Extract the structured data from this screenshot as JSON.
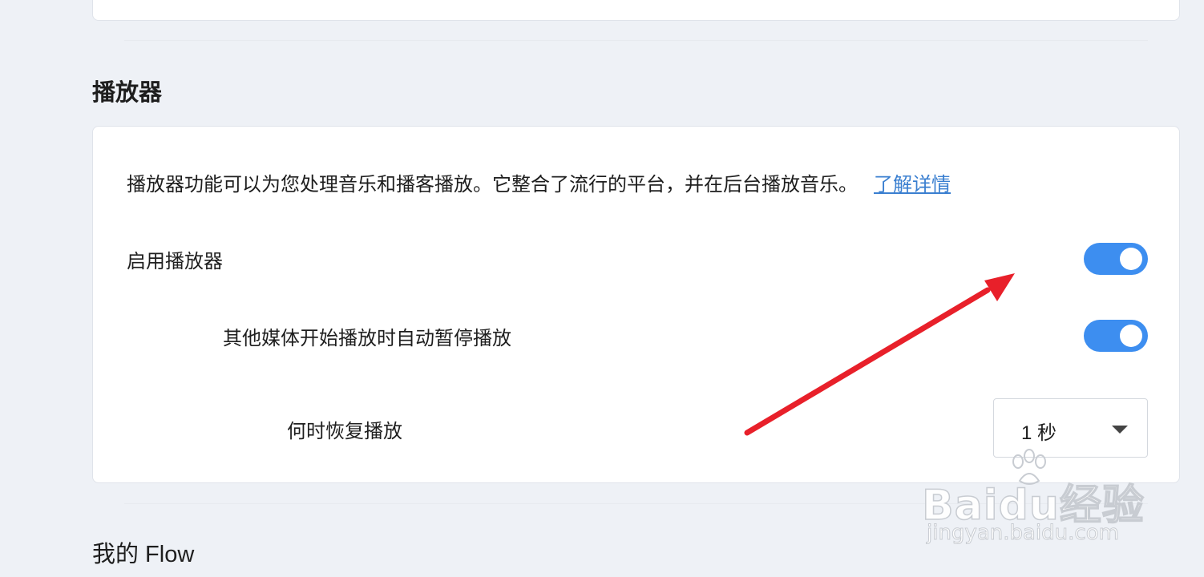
{
  "sections": {
    "player": {
      "title": "播放器",
      "description": "播放器功能可以为您处理音乐和播客播放。它整合了流行的平台，并在后台播放音乐。",
      "learn_more": "了解详情",
      "enable_label": "启用播放器",
      "enable_on": true,
      "autopause_label": "其他媒体开始播放时自动暂停播放",
      "autopause_on": true,
      "resume_label": "何时恢复播放",
      "resume_value": "1 秒"
    },
    "flow": {
      "title": "我的 Flow"
    }
  },
  "watermark": {
    "logo_text": "Bai",
    "logo_text_2": "du",
    "logo_cn": "经验",
    "url": "jingyan.baidu.com"
  },
  "colors": {
    "accent": "#3d8ef0",
    "link": "#3a7fd0",
    "annotation_arrow": "#e8202a",
    "page_bg": "#eef1f6"
  },
  "icons": {
    "select_caret": "chevron-down-icon",
    "annotation": "red-arrow-icon"
  }
}
